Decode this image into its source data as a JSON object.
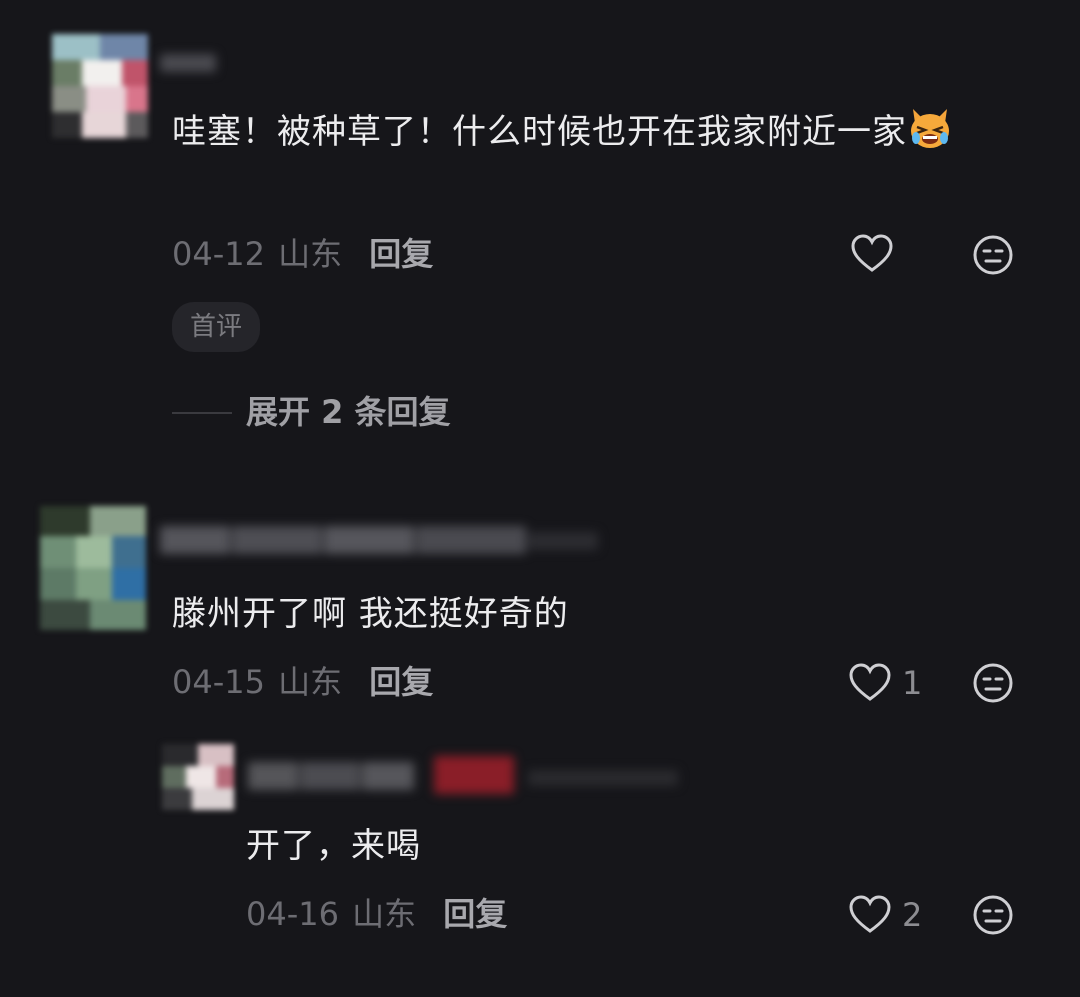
{
  "comments": [
    {
      "text": "哇塞！被种草了！什么时候也开在我家附近一家",
      "date": "04-12",
      "location": "山东",
      "reply_label": "回复",
      "badge": "首评",
      "likes": ""
    },
    {
      "text": "滕州开了啊 我还挺好奇的",
      "date": "04-15",
      "location": "山东",
      "reply_label": "回复",
      "likes": "1"
    }
  ],
  "expand_replies": "展开 2 条回复",
  "sub_reply": {
    "text": "开了，来喝",
    "date": "04-16",
    "location": "山东",
    "reply_label": "回复",
    "likes": "2"
  },
  "colors": {
    "background": "#16161a",
    "text": "#ececee",
    "meta": "#6d6d73",
    "icon": "#cfcfd3"
  },
  "icons": [
    "heart-icon",
    "dislike-face-icon",
    "crying-cat-emoji"
  ]
}
